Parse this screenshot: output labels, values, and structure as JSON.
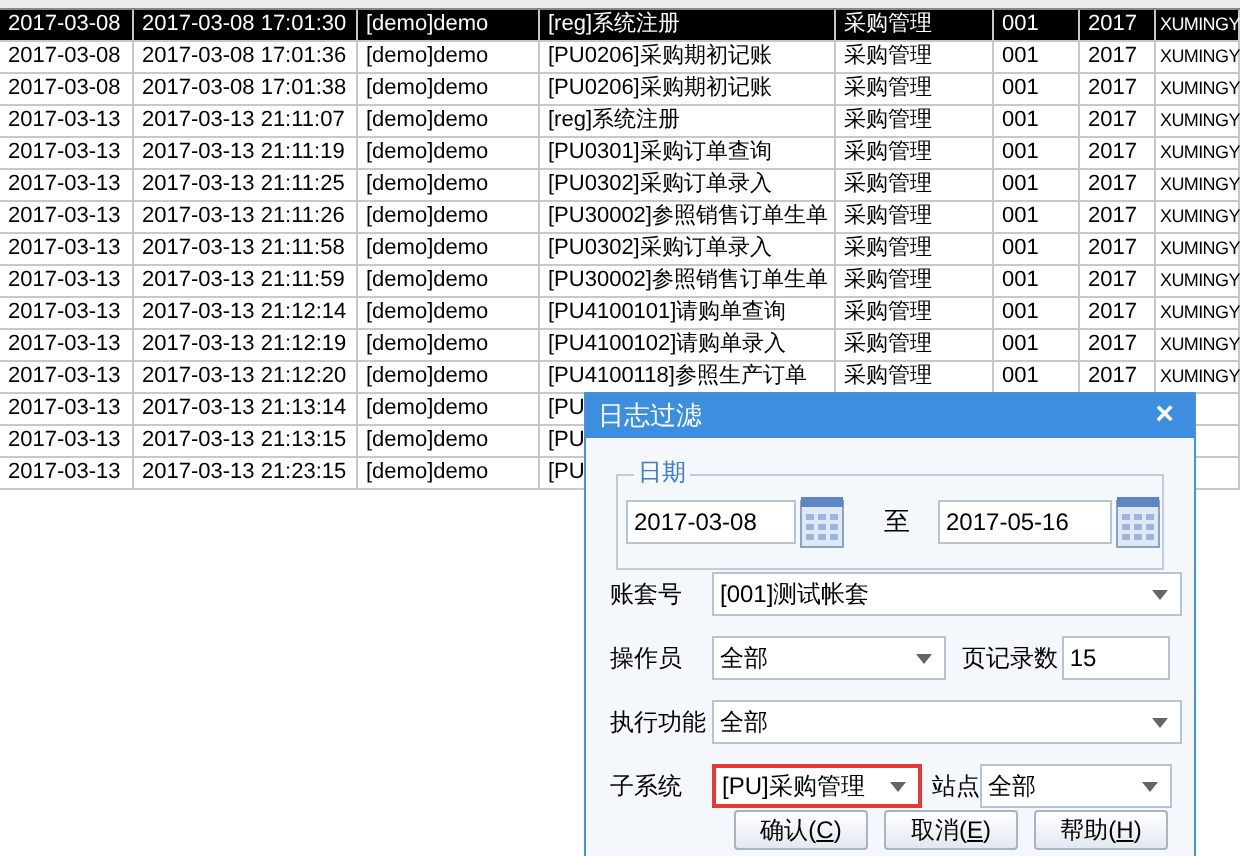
{
  "table": {
    "rows": [
      {
        "selected": true,
        "cells": [
          "2017-03-08",
          "2017-03-08 17:01:30",
          "[demo]demo",
          "[reg]系统注册",
          "采购管理",
          "001",
          "2017",
          "XUMINGY"
        ]
      },
      {
        "selected": false,
        "cells": [
          "2017-03-08",
          "2017-03-08 17:01:36",
          "[demo]demo",
          "[PU0206]采购期初记账",
          "采购管理",
          "001",
          "2017",
          "XUMINGY"
        ]
      },
      {
        "selected": false,
        "cells": [
          "2017-03-08",
          "2017-03-08 17:01:38",
          "[demo]demo",
          "[PU0206]采购期初记账",
          "采购管理",
          "001",
          "2017",
          "XUMINGY"
        ]
      },
      {
        "selected": false,
        "cells": [
          "2017-03-13",
          "2017-03-13 21:11:07",
          "[demo]demo",
          "[reg]系统注册",
          "采购管理",
          "001",
          "2017",
          "XUMINGY"
        ]
      },
      {
        "selected": false,
        "cells": [
          "2017-03-13",
          "2017-03-13 21:11:19",
          "[demo]demo",
          "[PU0301]采购订单查询",
          "采购管理",
          "001",
          "2017",
          "XUMINGY"
        ]
      },
      {
        "selected": false,
        "cells": [
          "2017-03-13",
          "2017-03-13 21:11:25",
          "[demo]demo",
          "[PU0302]采购订单录入",
          "采购管理",
          "001",
          "2017",
          "XUMINGY"
        ]
      },
      {
        "selected": false,
        "cells": [
          "2017-03-13",
          "2017-03-13 21:11:26",
          "[demo]demo",
          "[PU30002]参照销售订单生单",
          "采购管理",
          "001",
          "2017",
          "XUMINGY"
        ]
      },
      {
        "selected": false,
        "cells": [
          "2017-03-13",
          "2017-03-13 21:11:58",
          "[demo]demo",
          "[PU0302]采购订单录入",
          "采购管理",
          "001",
          "2017",
          "XUMINGY"
        ]
      },
      {
        "selected": false,
        "cells": [
          "2017-03-13",
          "2017-03-13 21:11:59",
          "[demo]demo",
          "[PU30002]参照销售订单生单",
          "采购管理",
          "001",
          "2017",
          "XUMINGY"
        ]
      },
      {
        "selected": false,
        "cells": [
          "2017-03-13",
          "2017-03-13 21:12:14",
          "[demo]demo",
          "[PU4100101]请购单查询",
          "采购管理",
          "001",
          "2017",
          "XUMINGY"
        ]
      },
      {
        "selected": false,
        "cells": [
          "2017-03-13",
          "2017-03-13 21:12:19",
          "[demo]demo",
          "[PU4100102]请购单录入",
          "采购管理",
          "001",
          "2017",
          "XUMINGY"
        ]
      },
      {
        "selected": false,
        "cells": [
          "2017-03-13",
          "2017-03-13 21:12:20",
          "[demo]demo",
          "[PU4100118]参照生产订单",
          "采购管理",
          "001",
          "2017",
          "XUMINGY"
        ]
      },
      {
        "selected": false,
        "cells": [
          "2017-03-13",
          "2017-03-13 21:13:14",
          "[demo]demo",
          "[PU"
        ]
      },
      {
        "selected": false,
        "cells": [
          "2017-03-13",
          "2017-03-13 21:13:15",
          "[demo]demo",
          "[PU"
        ]
      },
      {
        "selected": false,
        "cells": [
          "2017-03-13",
          "2017-03-13 21:23:15",
          "[demo]demo",
          "[PU"
        ]
      }
    ]
  },
  "dialog": {
    "title": "日志过滤",
    "close": "×",
    "date_group": {
      "legend": "日期",
      "from": "2017-03-08",
      "to_label": "至",
      "to": "2017-05-16"
    },
    "account": {
      "label": "账套号",
      "value": "[001]测试帐套"
    },
    "operator": {
      "label": "操作员",
      "value": "全部"
    },
    "page_size": {
      "label": "页记录数",
      "value": "15"
    },
    "function": {
      "label": "执行功能",
      "value": "全部"
    },
    "subsystem": {
      "label": "子系统",
      "value": "[PU]采购管理",
      "highlighted": true
    },
    "station": {
      "label": "站点",
      "value": "全部"
    },
    "buttons": [
      {
        "prefix": "确认(",
        "hotkey": "C",
        "suffix": ")"
      },
      {
        "prefix": "取消(",
        "hotkey": "E",
        "suffix": ")"
      },
      {
        "prefix": "帮助(",
        "hotkey": "H",
        "suffix": ")"
      }
    ]
  }
}
